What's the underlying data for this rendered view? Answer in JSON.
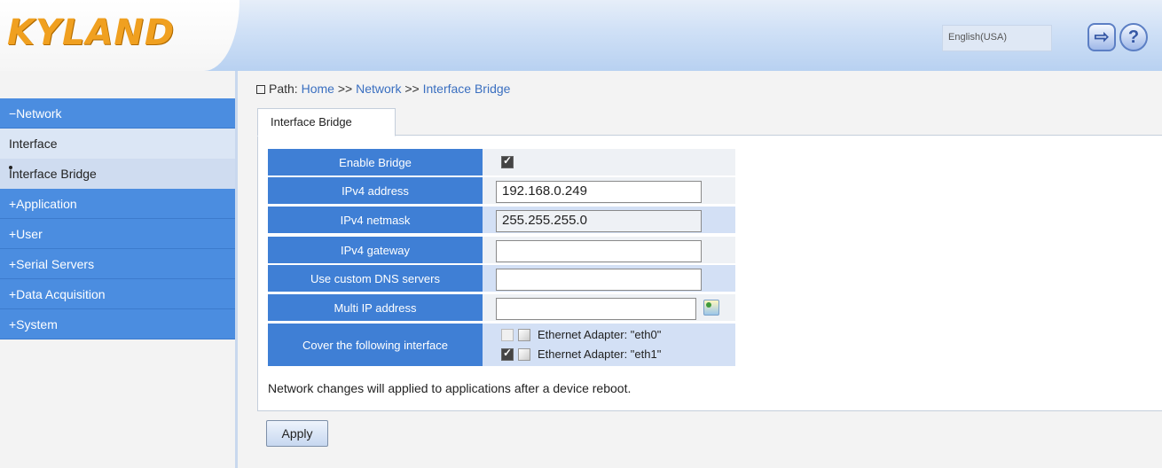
{
  "header": {
    "logo_text": "KYLAND",
    "language": "English(USA)"
  },
  "sidebar": {
    "items": [
      {
        "label": "−Network",
        "type": "category"
      },
      {
        "label": "Interface",
        "type": "sub"
      },
      {
        "label": "Interface Bridge",
        "type": "sub",
        "active": true
      },
      {
        "label": "+Application",
        "type": "category"
      },
      {
        "label": "+User",
        "type": "category"
      },
      {
        "label": "+Serial Servers",
        "type": "category"
      },
      {
        "label": "+Data Acquisition",
        "type": "category"
      },
      {
        "label": "+System",
        "type": "category"
      }
    ]
  },
  "path": {
    "prefix": "Path:",
    "home": "Home",
    "sep": ">>",
    "network": "Network",
    "current": "Interface Bridge"
  },
  "tab": {
    "label": "Interface Bridge"
  },
  "form": {
    "enable_bridge_label": "Enable Bridge",
    "enable_bridge_checked": true,
    "ipv4_address_label": "IPv4 address",
    "ipv4_address_value": "192.168.0.249",
    "ipv4_netmask_label": "IPv4 netmask",
    "ipv4_netmask_value": "255.255.255.0",
    "ipv4_gateway_label": "IPv4 gateway",
    "ipv4_gateway_value": "",
    "dns_label": "Use custom DNS servers",
    "dns_value": "",
    "multi_ip_label": "Multi IP address",
    "multi_ip_value": "",
    "cover_label": "Cover the following interface",
    "interfaces": [
      {
        "label": "Ethernet Adapter: \"eth0\"",
        "checked": false
      },
      {
        "label": "Ethernet Adapter: \"eth1\"",
        "checked": true
      }
    ]
  },
  "notice": "Network changes will applied to applications after a device reboot.",
  "apply_label": "Apply",
  "colors": {
    "accent_blue": "#3f7fd5",
    "sidebar_blue": "#4b8de0",
    "logo_orange": "#f0a020"
  }
}
